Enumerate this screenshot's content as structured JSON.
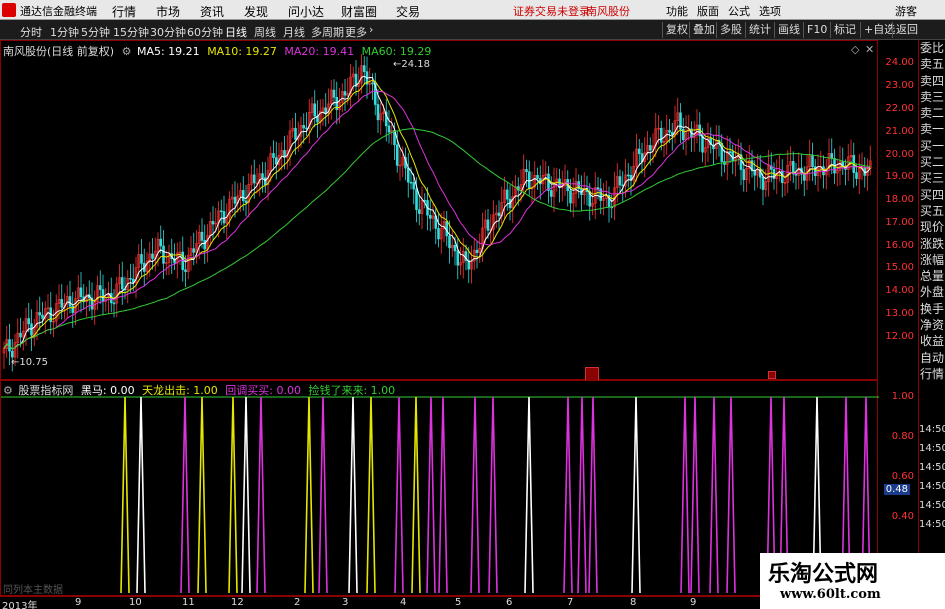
{
  "menubar": {
    "app_title": "通达信金融终端",
    "items": [
      "行情",
      "市场",
      "资讯",
      "发现",
      "问小达",
      "财富圈",
      "交易"
    ],
    "status": "证券交易未登录",
    "stock_name": "南风股份",
    "right_items": [
      "功能",
      "版面",
      "公式",
      "选项"
    ],
    "guest": "游客"
  },
  "periodbar": {
    "tabs": [
      "分时",
      "1分钟",
      "5分钟",
      "15分钟",
      "30分钟",
      "60分钟",
      "日线",
      "周线",
      "月线",
      "多周期",
      "更多"
    ],
    "active": "日线",
    "right_buttons": [
      "复权",
      "叠加",
      "多股",
      "统计",
      "画线",
      "F10",
      "标记",
      "+自选",
      "返回"
    ]
  },
  "main_legend": {
    "title": "南风股份(日线 前复权)",
    "ma5": "MA5: 19.21",
    "ma10": "MA10: 19.27",
    "ma20": "MA20: 19.41",
    "ma60": "MA60: 19.29"
  },
  "ind_legend": {
    "title": "股票指标网",
    "heima": "黑马: 0.00",
    "tianlong": "天龙出击: 1.00",
    "huitiao": "回调买买: 0.00",
    "jianqian": "捡钱了来来: 1.00"
  },
  "price_axis": [
    "24.00",
    "23.00",
    "22.00",
    "21.00",
    "20.00",
    "19.00",
    "18.00",
    "17.00",
    "16.00",
    "15.00",
    "14.00",
    "13.00",
    "12.00"
  ],
  "ind_axis": [
    "1.00",
    "0.80",
    "0.60",
    "0.40"
  ],
  "annotations": {
    "high": "24.18",
    "low": "10.75"
  },
  "right_panel": [
    "委比",
    "卖五",
    "卖四",
    "卖三",
    "卖二",
    "卖一",
    "买一",
    "买二",
    "买三",
    "买四",
    "买五",
    "现价",
    "涨跌",
    "涨幅",
    "总量",
    "外盘",
    "换手",
    "净资",
    "收益",
    "自动",
    "行情"
  ],
  "time_list": [
    "14:50",
    "14:50",
    "14:50",
    "14:50",
    "14:50",
    "14:50"
  ],
  "current_value": "0.48",
  "time_axis": [
    "2013年",
    "9",
    "10",
    "11",
    "12",
    "2",
    "3",
    "4",
    "5",
    "6",
    "7",
    "8",
    "9"
  ],
  "bottom_text": "同列本主数据",
  "watermark": {
    "line1": "乐淘公式网",
    "line2": "www.60lt.com"
  },
  "colors": {
    "ma5": "#ffffff",
    "ma10": "#e6e600",
    "ma20": "#dd33dd",
    "ma60": "#33cc33",
    "up": "#ff3333",
    "down": "#33dddd"
  }
}
